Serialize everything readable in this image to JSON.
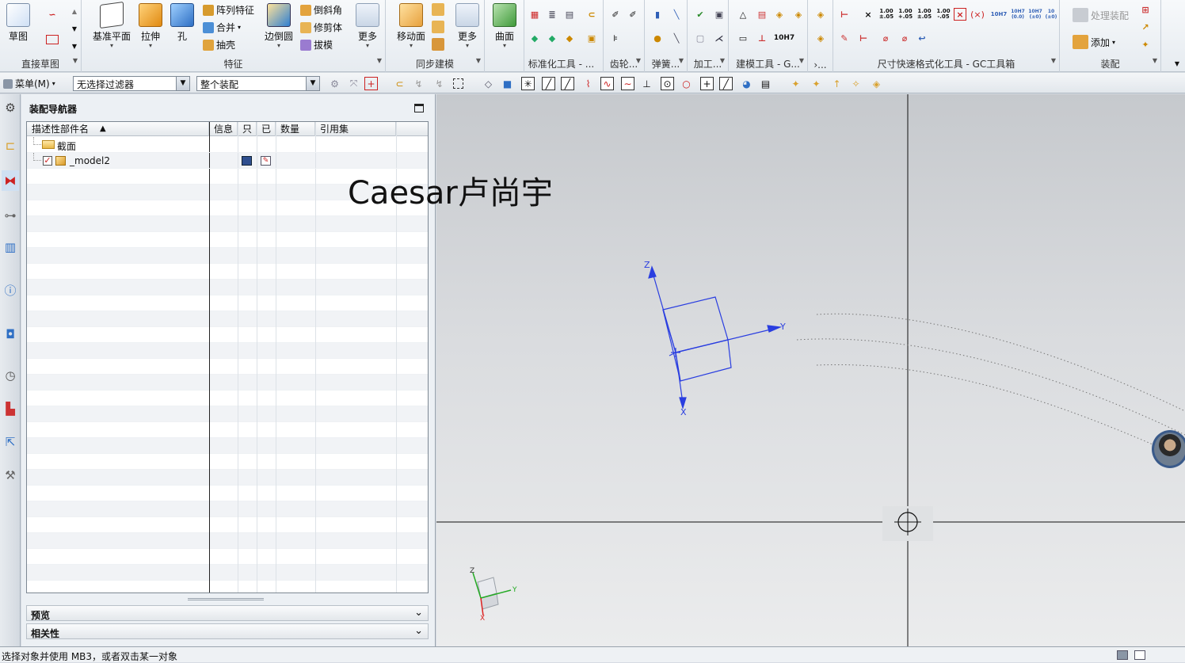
{
  "ribbon": {
    "groups": [
      {
        "label": "直接草图",
        "buttons": [
          "草图"
        ]
      },
      {
        "label": "特征",
        "buttons": [
          "基准平面",
          "拉伸",
          "孔",
          "边倒圆",
          "更多"
        ],
        "small": [
          "阵列特征",
          "合并",
          "抽壳",
          "倒斜角",
          "修剪体",
          "拔模"
        ]
      },
      {
        "label": "同步建模",
        "buttons": [
          "移动面",
          "更多"
        ]
      },
      {
        "label": "",
        "buttons": [
          "曲面"
        ]
      },
      {
        "label": "标准化工具 - ..."
      },
      {
        "label": "齿轮..."
      },
      {
        "label": "弹簧..."
      },
      {
        "label": "加工..."
      },
      {
        "label": "建模工具 - G..."
      },
      {
        "label": "›..."
      },
      {
        "label": "尺寸快速格式化工具 - GC工具箱"
      },
      {
        "label": "装配",
        "small": [
          "处理装配",
          "添加"
        ]
      }
    ],
    "dim_labels": [
      "1.00 ±.05",
      "1.00 +.05",
      "1.00 ±.05",
      "1.00 -.05",
      "10H7",
      "10H7 (0.0)",
      "10H7 (±0)",
      "10 (±0)"
    ]
  },
  "toolbar": {
    "menu_label": "菜单(M)",
    "filter_value": "无选择过滤器",
    "scope_value": "整个装配"
  },
  "navigator": {
    "title": "装配导航器",
    "columns": [
      "描述性部件名",
      "信息",
      "只",
      "已",
      "数量",
      "引用集"
    ],
    "rows": [
      {
        "name": "截面"
      },
      {
        "name": "_model2"
      }
    ],
    "sections": [
      "预览",
      "相关性"
    ]
  },
  "viewport": {
    "watermark": "Caesar卢尚宇",
    "axes": {
      "x": "X",
      "y": "Y",
      "z": "Z"
    }
  },
  "status": {
    "text": "选择对象并使用 MB3，或者双击某一对象"
  },
  "colors": {
    "csys_blue": "#2a3ee0",
    "axis_red": "#d22",
    "axis_green": "#2a2"
  }
}
